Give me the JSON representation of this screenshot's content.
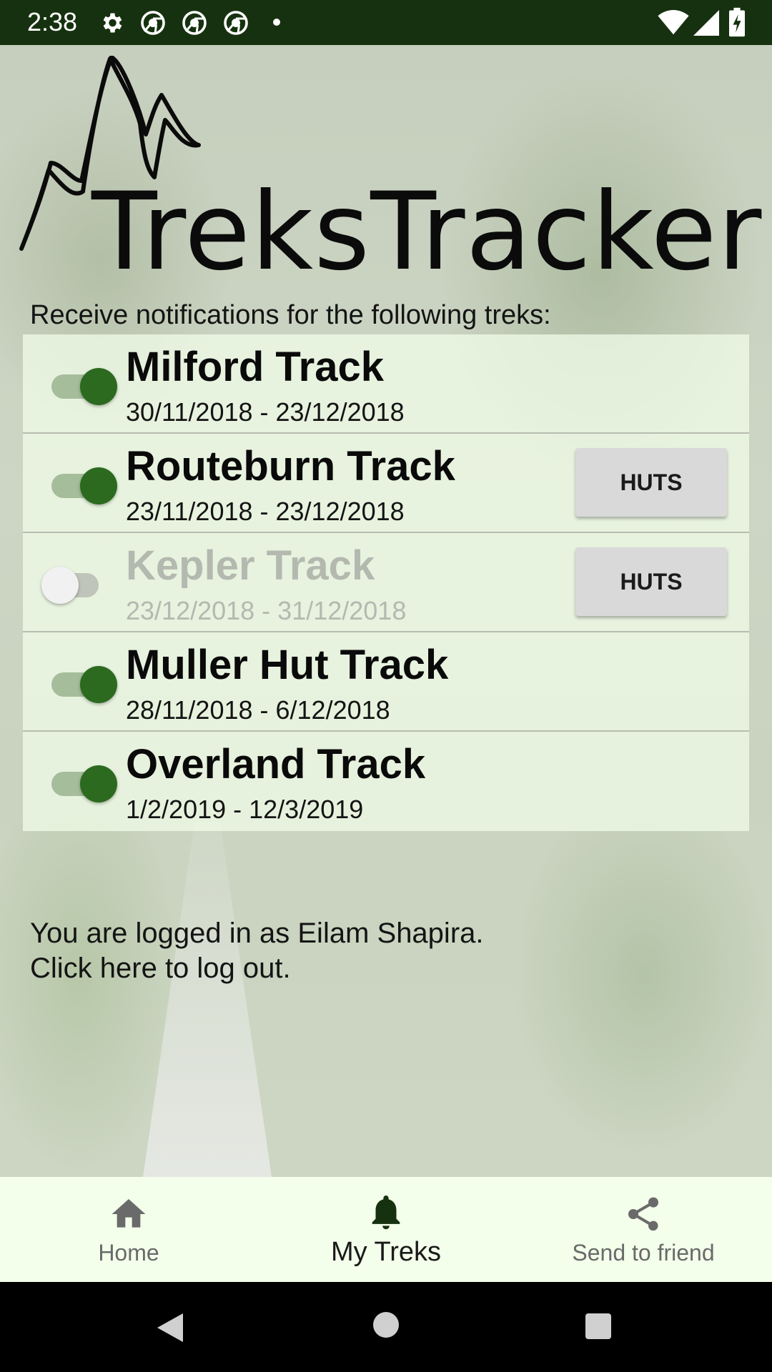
{
  "status_bar": {
    "time": "2:38",
    "icons": [
      "gear-icon",
      "chrome-icon",
      "chrome-icon",
      "chrome-icon",
      "dot-icon",
      "wifi-icon",
      "signal-icon",
      "battery-icon"
    ]
  },
  "app": {
    "logo_text": "TreksTracker",
    "intro": "Receive notifications for the following treks:"
  },
  "treks": [
    {
      "name": "Milford Track",
      "dates": "30/11/2018 - 23/12/2018",
      "enabled": true,
      "huts": false
    },
    {
      "name": "Routeburn Track",
      "dates": "23/11/2018 - 23/12/2018",
      "enabled": true,
      "huts": true
    },
    {
      "name": "Kepler Track",
      "dates": "23/12/2018 - 31/12/2018",
      "enabled": false,
      "huts": true
    },
    {
      "name": "Muller Hut Track",
      "dates": "28/11/2018 - 6/12/2018",
      "enabled": true,
      "huts": false
    },
    {
      "name": "Overland Track",
      "dates": "1/2/2019 - 12/3/2019",
      "enabled": true,
      "huts": false
    }
  ],
  "huts_label": "HUTS",
  "login": {
    "line1": "You are logged in as Eilam Shapira.",
    "line2": "Click here to log out."
  },
  "bottom_nav": [
    {
      "label": "Home",
      "icon": "home-icon",
      "active": false
    },
    {
      "label": "My Treks",
      "icon": "bell-icon",
      "active": true
    },
    {
      "label": "Send to friend",
      "icon": "share-icon",
      "active": false
    }
  ],
  "colors": {
    "accent": "#2c6a1f",
    "status_bar": "#16310f",
    "nav_background": "#f3ffea",
    "row_background": "#f0fce8"
  }
}
